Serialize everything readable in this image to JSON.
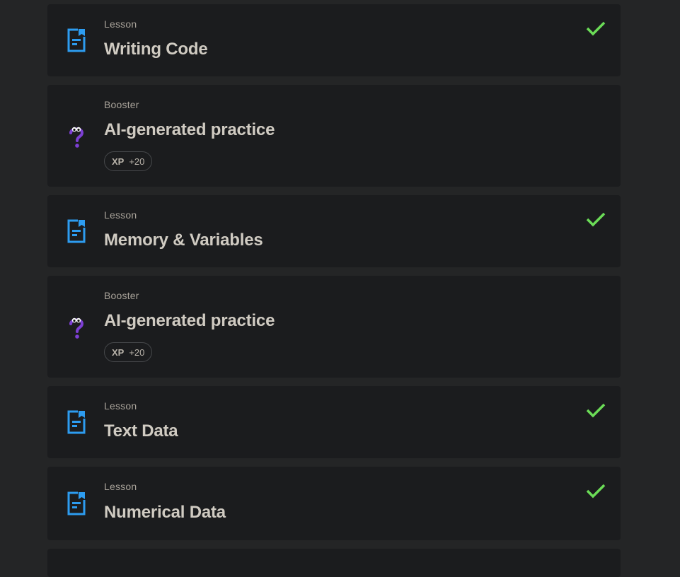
{
  "items": [
    {
      "type_label": "Lesson",
      "title": "Writing Code",
      "icon": "lesson-document-icon",
      "completed": true
    },
    {
      "type_label": "Booster",
      "title": "AI-generated practice",
      "icon": "booster-question-icon",
      "completed": false,
      "xp_label": "XP",
      "xp_value": "+20"
    },
    {
      "type_label": "Lesson",
      "title": "Memory & Variables",
      "icon": "lesson-document-icon",
      "completed": true
    },
    {
      "type_label": "Booster",
      "title": "AI-generated practice",
      "icon": "booster-question-icon",
      "completed": false,
      "xp_label": "XP",
      "xp_value": "+20"
    },
    {
      "type_label": "Lesson",
      "title": "Text Data",
      "icon": "lesson-document-icon",
      "completed": true
    },
    {
      "type_label": "Lesson",
      "title": "Numerical Data",
      "icon": "lesson-document-icon",
      "completed": true
    }
  ],
  "colors": {
    "background": "#242526",
    "card": "#1b1c1e",
    "lesson_icon": "#2d9cf0",
    "booster_icon": "#7d3fd4",
    "check": "#6bdc57",
    "title": "#d0cbc2",
    "label": "#a9a39a"
  }
}
